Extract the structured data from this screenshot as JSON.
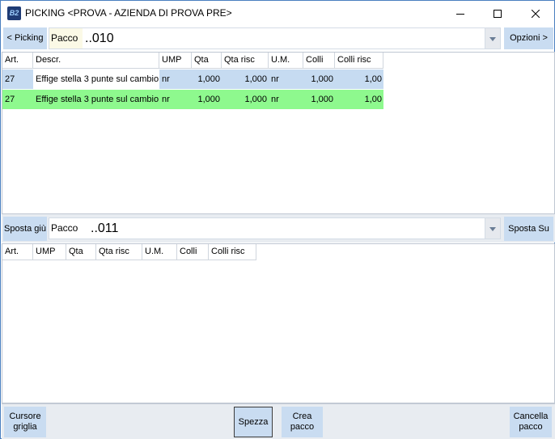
{
  "window": {
    "title": "PICKING <PROVA - AZIENDA DI PROVA PRE>",
    "app_icon_text": "B2",
    "icons": {
      "app": "app-logo-icon",
      "minimize": "minimize-icon",
      "maximize": "maximize-icon",
      "close": "close-icon"
    }
  },
  "top": {
    "back_button": "< Picking",
    "options_button": "Opzioni >",
    "package_label": "Pacco",
    "package_value": "..010",
    "columns": [
      "Art.",
      "Descr.",
      "UMP",
      "Qta",
      "Qta risc",
      "U.M.",
      "Colli",
      "Colli risc"
    ],
    "rows": [
      {
        "art": "27",
        "descr": "Effige stella 3 punte sul cambio",
        "ump": "nr",
        "qta": "1,000",
        "qta_risc": "1,000",
        "um": "nr",
        "colli": "1,000",
        "colli_risc": "1,00",
        "color": "#c6dbf1",
        "descr_color": "#ffffff"
      },
      {
        "art": "27",
        "descr": "Effige stella 3 punte sul cambio",
        "ump": "nr",
        "qta": "1,000",
        "qta_risc": "1,000",
        "um": "nr",
        "colli": "1,000",
        "colli_risc": "1,00",
        "color": "#8ef98e",
        "descr_color": "#8ef98e"
      }
    ]
  },
  "middle": {
    "move_down_button": "Sposta giù",
    "move_up_button": "Sposta Su",
    "package_label": "Pacco",
    "package_value": "..011",
    "columns": [
      "Art.",
      "UMP",
      "Qta",
      "Qta risc",
      "U.M.",
      "Colli",
      "Colli risc"
    ]
  },
  "bottom": {
    "cursor_grid_button": "Cursore griglia",
    "split_button": "Spezza",
    "create_package_button": "Crea pacco",
    "delete_package_button": "Cancella pacco"
  },
  "colors": {
    "button": "#c9dcf1",
    "row_selected": "#c6dbf1",
    "row_green": "#8ef98e",
    "label_bg": "#fbf9e6",
    "panel_bg": "#e8ecf1"
  }
}
